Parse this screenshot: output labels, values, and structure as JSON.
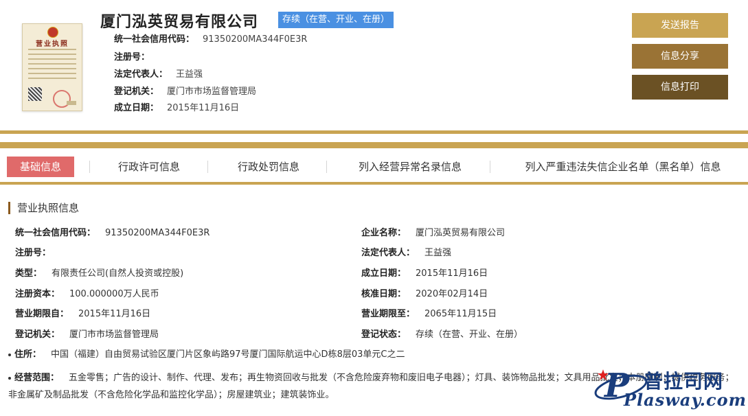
{
  "header": {
    "license_image_title": "营业执照",
    "company_name": "厦门泓英贸易有限公司",
    "status": "存续（在营、开业、在册）",
    "fields": [
      {
        "label": "统一社会信用代码：",
        "value": "91350200MA344F0E3R"
      },
      {
        "label": "注册号：",
        "value": ""
      },
      {
        "label": "法定代表人：",
        "value": "王益强"
      },
      {
        "label": "登记机关：",
        "value": "厦门市市场监督管理局"
      },
      {
        "label": "成立日期：",
        "value": "2015年11月16日"
      }
    ]
  },
  "actions": {
    "send_report": "发送报告",
    "share": "信息分享",
    "print": "信息打印"
  },
  "tabs": [
    {
      "label": "基础信息",
      "active": true
    },
    {
      "label": "行政许可信息",
      "active": false
    },
    {
      "label": "行政处罚信息",
      "active": false
    },
    {
      "label": "列入经营异常名录信息",
      "active": false
    },
    {
      "label": "列入严重违法失信企业名单（黑名单）信息",
      "active": false
    }
  ],
  "section": {
    "title": "营业执照信息",
    "left": [
      {
        "label": "统一社会信用代码：",
        "value": "91350200MA344F0E3R"
      },
      {
        "label": "注册号：",
        "value": ""
      },
      {
        "label": "类型：",
        "value": "有限责任公司(自然人投资或控股)"
      },
      {
        "label": "注册资本：",
        "value": "100.000000万人民币"
      },
      {
        "label": "营业期限自：",
        "value": "2015年11月16日"
      },
      {
        "label": "登记机关：",
        "value": "厦门市市场监督管理局"
      }
    ],
    "right": [
      {
        "label": "企业名称：",
        "value": "厦门泓英贸易有限公司"
      },
      {
        "label": "法定代表人：",
        "value": "王益强"
      },
      {
        "label": "成立日期：",
        "value": "2015年11月16日"
      },
      {
        "label": "核准日期：",
        "value": "2020年02月14日"
      },
      {
        "label": "营业期限至：",
        "value": "2065年11月15日"
      },
      {
        "label": "登记状态：",
        "value": "存续（在营、开业、在册）"
      }
    ],
    "address": {
      "label": "住所：",
      "value": "中国（福建）自由贸易试验区厦门片区象屿路97号厦门国际航运中心D栋8层03单元C之二"
    },
    "scope": {
      "label": "经营范围：",
      "value": "五金零售；广告的设计、制作、代理、发布；再生物资回收与批发（不含危险废弃物和废旧电子电器）；灯具、装饰物品批发；文具用品批发；本册印制；提供税务服务；非金属矿及制品批发（不含危险化学品和监控化学品）；房屋建筑业；建筑装饰业。"
    }
  },
  "watermark": {
    "brand_cn": "普拉司网",
    "brand_en": "Plasway.com"
  },
  "colors": {
    "gold": "#c9a452",
    "brown": "#9a7335",
    "dark_brown": "#6b5124",
    "active_tab": "#e06a6a",
    "status_blue": "#4a90e2"
  }
}
